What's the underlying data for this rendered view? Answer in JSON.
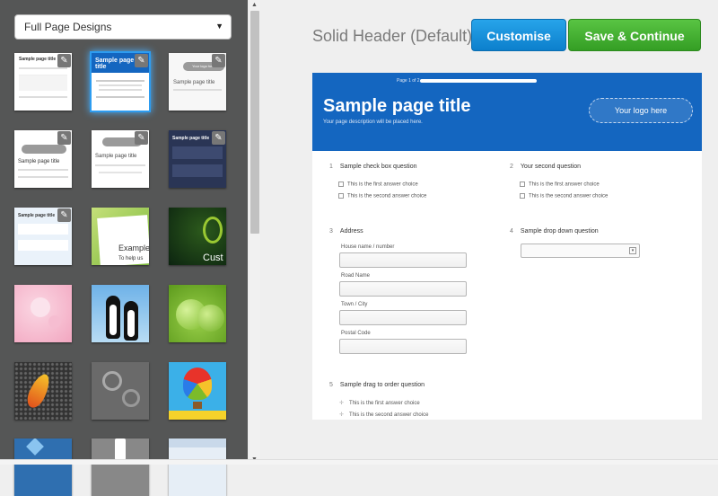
{
  "sidebar": {
    "dropdown_value": "Full Page Designs",
    "thumbnails": [
      {
        "name": "thumb-full-page-1",
        "text": "Sample page title"
      },
      {
        "name": "thumb-solid-header",
        "text": "Sample page title"
      },
      {
        "name": "thumb-grey-logo",
        "text": "Your logo here"
      },
      {
        "name": "thumb-grey-header",
        "text": "Sample page title"
      },
      {
        "name": "thumb-plain-logo",
        "text": "Sample page title"
      },
      {
        "name": "thumb-dark-navy",
        "text": "Sample page title"
      },
      {
        "name": "thumb-light-blue",
        "text": "Sample page title"
      },
      {
        "name": "thumb-notepad-green",
        "text": "Example"
      },
      {
        "name": "thumb-dark-swirl",
        "text": "Cust"
      },
      {
        "name": "thumb-pink-blossom",
        "text": ""
      },
      {
        "name": "thumb-penguins",
        "text": ""
      },
      {
        "name": "thumb-green-apples",
        "text": ""
      },
      {
        "name": "thumb-feather",
        "text": ""
      },
      {
        "name": "thumb-grey-floral",
        "text": ""
      },
      {
        "name": "thumb-hot-air-balloon",
        "text": ""
      },
      {
        "name": "thumb-blue-floral",
        "text": ""
      },
      {
        "name": "thumb-vase",
        "text": ""
      },
      {
        "name": "thumb-light-blue-2",
        "text": ""
      }
    ],
    "thumb_texts": {
      "notepad_sub": "To help us"
    }
  },
  "header": {
    "design_title": "Solid Header (Default)",
    "customise_label": "Customise",
    "save_label": "Save & Continue"
  },
  "preview": {
    "progress_text": "Page 1 of 2",
    "title": "Sample page title",
    "description": "Your page description will be placed here.",
    "logo_text": "Your logo here",
    "questions": [
      {
        "num": "1",
        "text": "Sample check box question"
      },
      {
        "num": "2",
        "text": "Your second question"
      },
      {
        "num": "3",
        "text": "Address"
      },
      {
        "num": "4",
        "text": "Sample drop down question"
      },
      {
        "num": "5",
        "text": "Sample drag to order question"
      }
    ],
    "q1_options": [
      "This is the first answer choice",
      "This is the second answer choice"
    ],
    "q2_options": [
      "This is the first answer choice",
      "This is the second answer choice"
    ],
    "address_fields": [
      "House name / number",
      "Road Name",
      "Town / City",
      "Postal Code"
    ],
    "drag_options": [
      "This is the first answer choice",
      "This is the second answer choice"
    ]
  },
  "colors": {
    "header_blue": "#1466c0",
    "customise_blue": "#1a90dc",
    "save_green": "#46b233",
    "sidebar_bg": "#555656"
  }
}
